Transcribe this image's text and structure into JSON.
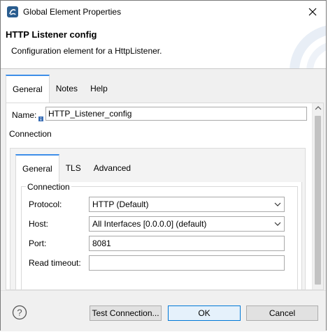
{
  "window": {
    "title": "Global Element Properties",
    "close_symbol": "✕"
  },
  "header": {
    "title": "HTTP Listener config",
    "description": "Configuration element for a HttpListener."
  },
  "tabs": [
    {
      "label": "General",
      "active": true
    },
    {
      "label": "Notes",
      "active": false
    },
    {
      "label": "Help",
      "active": false
    }
  ],
  "general": {
    "name_label": "Name:",
    "name_value": "HTTP_Listener_config",
    "connection_label": "Connection"
  },
  "connection_tabs": [
    {
      "label": "General",
      "active": true
    },
    {
      "label": "TLS",
      "active": false
    },
    {
      "label": "Advanced",
      "active": false
    }
  ],
  "connection_group": {
    "legend": "Connection",
    "protocol_label": "Protocol:",
    "protocol_value": "HTTP (Default)",
    "host_label": "Host:",
    "host_value": "All Interfaces [0.0.0.0] (default)",
    "port_label": "Port:",
    "port_value": "8081",
    "read_timeout_label": "Read timeout:",
    "read_timeout_value": ""
  },
  "footer": {
    "help_symbol": "?",
    "test_connection_label": "Test Connection...",
    "ok_label": "OK",
    "cancel_label": "Cancel"
  },
  "colors": {
    "accent": "#3d8ee9",
    "default_button_border": "#0078d7"
  }
}
